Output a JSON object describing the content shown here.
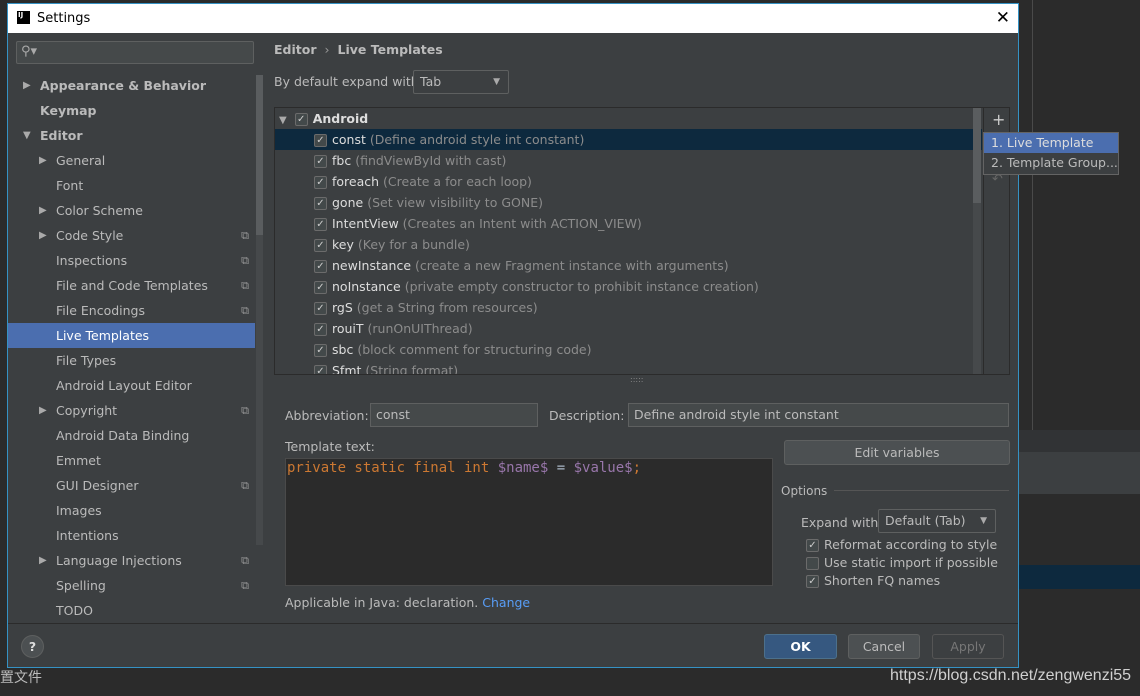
{
  "window": {
    "title": "Settings"
  },
  "background": {
    "text": "置文件",
    "watermark": "https://blog.csdn.net/zengwenzi55"
  },
  "sidebar": {
    "items": [
      {
        "label": "Appearance & Behavior",
        "level": 0,
        "expandable": true,
        "bold": true
      },
      {
        "label": "Keymap",
        "level": 0,
        "bold": true
      },
      {
        "label": "Editor",
        "level": 0,
        "expandable": true,
        "expanded": true,
        "bold": true
      },
      {
        "label": "General",
        "level": 1,
        "expandable": true
      },
      {
        "label": "Font",
        "level": 1
      },
      {
        "label": "Color Scheme",
        "level": 1,
        "expandable": true
      },
      {
        "label": "Code Style",
        "level": 1,
        "expandable": true,
        "project": true
      },
      {
        "label": "Inspections",
        "level": 1,
        "project": true
      },
      {
        "label": "File and Code Templates",
        "level": 1,
        "project": true
      },
      {
        "label": "File Encodings",
        "level": 1,
        "project": true
      },
      {
        "label": "Live Templates",
        "level": 1,
        "selected": true
      },
      {
        "label": "File Types",
        "level": 1
      },
      {
        "label": "Android Layout Editor",
        "level": 1
      },
      {
        "label": "Copyright",
        "level": 1,
        "expandable": true,
        "project": true
      },
      {
        "label": "Android Data Binding",
        "level": 1
      },
      {
        "label": "Emmet",
        "level": 1
      },
      {
        "label": "GUI Designer",
        "level": 1,
        "project": true
      },
      {
        "label": "Images",
        "level": 1
      },
      {
        "label": "Intentions",
        "level": 1
      },
      {
        "label": "Language Injections",
        "level": 1,
        "expandable": true,
        "project": true
      },
      {
        "label": "Spelling",
        "level": 1,
        "project": true
      },
      {
        "label": "TODO",
        "level": 1
      }
    ]
  },
  "breadcrumb": {
    "parent": "Editor",
    "current": "Live Templates"
  },
  "expand_default": {
    "label": "By default expand with",
    "value": "Tab"
  },
  "tree": {
    "group": "Android",
    "items": [
      {
        "abbr": "const",
        "desc": "(Define android style int constant)",
        "selected": true
      },
      {
        "abbr": "fbc",
        "desc": "(findViewById with cast)"
      },
      {
        "abbr": "foreach",
        "desc": "(Create a for each loop)"
      },
      {
        "abbr": "gone",
        "desc": "(Set view visibility to GONE)"
      },
      {
        "abbr": "IntentView",
        "desc": "(Creates an Intent with ACTION_VIEW)"
      },
      {
        "abbr": "key",
        "desc": "(Key for a bundle)"
      },
      {
        "abbr": "newInstance",
        "desc": "(create a new Fragment instance with arguments)"
      },
      {
        "abbr": "noInstance",
        "desc": "(private empty constructor to prohibit instance creation)"
      },
      {
        "abbr": "rgS",
        "desc": "(get a String from resources)"
      },
      {
        "abbr": "rouiT",
        "desc": "(runOnUIThread)"
      },
      {
        "abbr": "sbc",
        "desc": "(block comment for structuring code)"
      },
      {
        "abbr": "Sfmt",
        "desc": "(String format)"
      }
    ]
  },
  "popup": {
    "items": [
      "1. Live Template",
      "2. Template Group..."
    ]
  },
  "form": {
    "abbreviation_label": "Abbreviation:",
    "abbreviation": "const",
    "description_label": "Description:",
    "description": "Define android style int constant",
    "template_text_label": "Template text:",
    "code": {
      "kw": "private static final int ",
      "name": "$name$",
      "eq": " = ",
      "value": "$value$",
      "end": ";"
    },
    "edit_variables": "Edit variables",
    "applicable": "Applicable in Java: declaration.",
    "change": "Change"
  },
  "options": {
    "title": "Options",
    "expand_label": "Expand with",
    "expand_value": "Default (Tab)",
    "checks": [
      {
        "label": "Reformat according to style",
        "checked": true
      },
      {
        "label": "Use static import if possible",
        "checked": false
      },
      {
        "label": "Shorten FQ names",
        "checked": true
      }
    ]
  },
  "footer": {
    "help": "?",
    "ok": "OK",
    "cancel": "Cancel",
    "apply": "Apply"
  }
}
